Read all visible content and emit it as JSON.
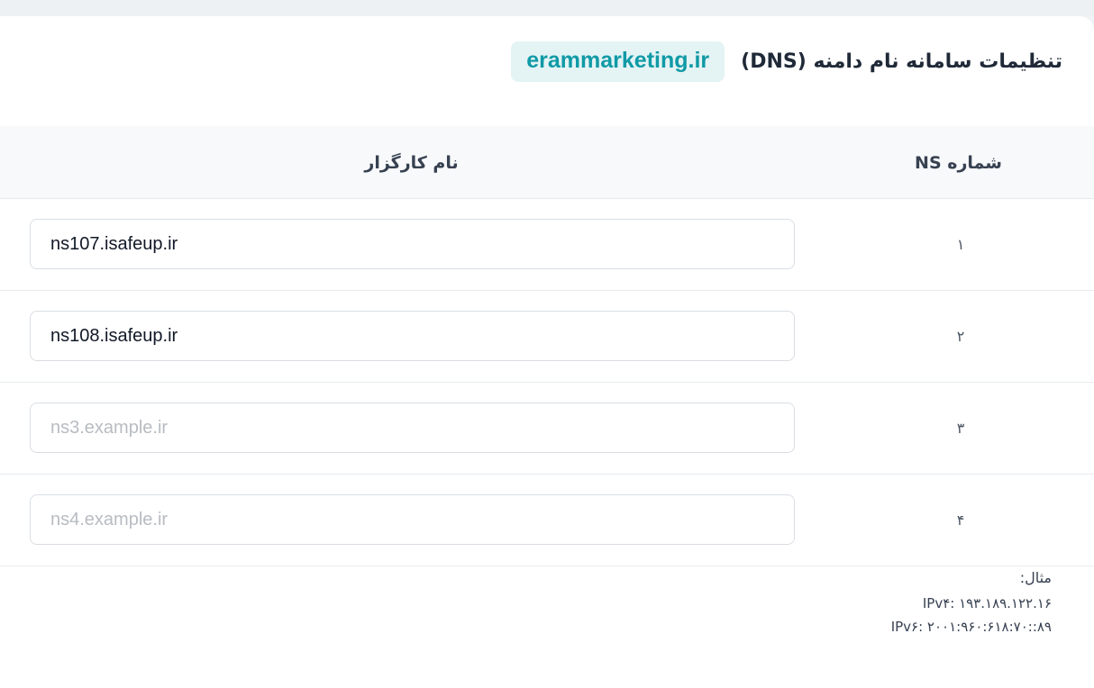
{
  "header": {
    "title": "تنظیمات سامانه نام دامنه (DNS)",
    "domain": "erammarketing.ir"
  },
  "table": {
    "columns": {
      "ns_number": "شماره NS",
      "server_name": "نام کارگزار"
    },
    "rows": [
      {
        "number": "۱",
        "value": "ns107.isafeup.ir",
        "placeholder": ""
      },
      {
        "number": "۲",
        "value": "ns108.isafeup.ir",
        "placeholder": ""
      },
      {
        "number": "۳",
        "value": "",
        "placeholder": "ns3.example.ir"
      },
      {
        "number": "۴",
        "value": "",
        "placeholder": "ns4.example.ir"
      }
    ]
  },
  "example": {
    "label": "مثال:",
    "ipv4": "IPv۴: ۱۹۳.۱۸۹.۱۲۲.۱۶",
    "ipv6": "IPv۶: ۲۰۰۱:۹۶۰:۶۱۸:۷۰::۸۹"
  },
  "colors": {
    "accent": "#0f9aa6",
    "badge_bg": "#e4f3f4"
  }
}
